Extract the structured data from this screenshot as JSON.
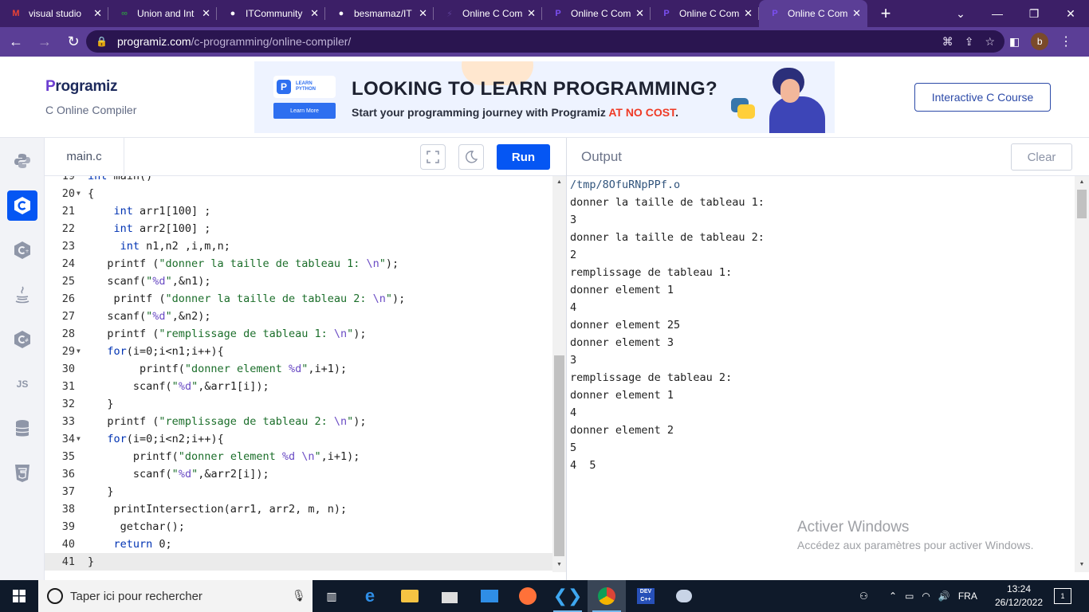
{
  "browser": {
    "tabs": [
      {
        "title": "visual studio",
        "icon": "gmail-icon",
        "active": false
      },
      {
        "title": "Union and Int",
        "icon": "geeksforgeeks-icon",
        "active": false
      },
      {
        "title": "ITCommunity",
        "icon": "github-icon",
        "active": false
      },
      {
        "title": "besmamaz/IT",
        "icon": "github-icon",
        "active": false
      },
      {
        "title": "Online C Com",
        "icon": "replit-icon",
        "active": false
      },
      {
        "title": "Online C Com",
        "icon": "programiz-icon",
        "active": false
      },
      {
        "title": "Online C Com",
        "icon": "programiz-icon",
        "active": false
      },
      {
        "title": "Online C Com",
        "icon": "programiz-icon",
        "active": true
      }
    ],
    "url_host": "programiz.com",
    "url_path": "/c-programming/online-compiler/",
    "profile_initial": "b",
    "colors": {
      "tabbar": "#3c1f67",
      "addressbar": "#5b3e96"
    }
  },
  "site": {
    "logo_text": "rogramiz",
    "logo_mark": "P",
    "subtitle": "C Online Compiler",
    "banner": {
      "card_text": "LEARN PYTHON",
      "button": "Learn More",
      "headline": "LOOKING TO LEARN PROGRAMMING?",
      "tagline_start": "Start your programming journey with Programiz ",
      "tagline_highlight": "AT NO COST",
      "tagline_end": "."
    },
    "course_button": "Interactive C Course",
    "accent_color": "#0556f3"
  },
  "sidebar": {
    "languages": [
      {
        "name": "python-icon",
        "active": false
      },
      {
        "name": "c-icon",
        "active": true
      },
      {
        "name": "cpp-icon",
        "active": false
      },
      {
        "name": "java-icon",
        "active": false
      },
      {
        "name": "csharp-icon",
        "active": false
      },
      {
        "name": "javascript-icon",
        "label": "JS",
        "active": false
      },
      {
        "name": "sql-icon",
        "active": false
      },
      {
        "name": "html5-icon",
        "active": false
      }
    ]
  },
  "editor": {
    "filename": "main.c",
    "run_label": "Run",
    "lines": [
      {
        "n": "19",
        "code": "int main()",
        "fold": false
      },
      {
        "n": "20",
        "code": "{",
        "fold": true
      },
      {
        "n": "21",
        "code": "    int arr1[100] ;",
        "fold": false
      },
      {
        "n": "22",
        "code": "    int arr2[100] ;",
        "fold": false
      },
      {
        "n": "23",
        "code": "     int n1,n2 ,i,m,n;",
        "fold": false
      },
      {
        "n": "24",
        "code": "   printf (\"donner la taille de tableau 1: \\n\");",
        "fold": false
      },
      {
        "n": "25",
        "code": "   scanf(\"%d\",&n1);",
        "fold": false
      },
      {
        "n": "26",
        "code": "    printf (\"donner la taille de tableau 2: \\n\");",
        "fold": false
      },
      {
        "n": "27",
        "code": "   scanf(\"%d\",&n2);",
        "fold": false
      },
      {
        "n": "28",
        "code": "   printf (\"remplissage de tableau 1: \\n\");",
        "fold": false
      },
      {
        "n": "29",
        "code": "   for(i=0;i<n1;i++){",
        "fold": true
      },
      {
        "n": "30",
        "code": "        printf(\"donner element %d\",i+1);",
        "fold": false
      },
      {
        "n": "31",
        "code": "       scanf(\"%d\",&arr1[i]);",
        "fold": false
      },
      {
        "n": "32",
        "code": "   }",
        "fold": false
      },
      {
        "n": "33",
        "code": "   printf (\"remplissage de tableau 2: \\n\");",
        "fold": false
      },
      {
        "n": "34",
        "code": "   for(i=0;i<n2;i++){",
        "fold": true
      },
      {
        "n": "35",
        "code": "       printf(\"donner element %d \\n\",i+1);",
        "fold": false
      },
      {
        "n": "36",
        "code": "       scanf(\"%d\",&arr2[i]);",
        "fold": false
      },
      {
        "n": "37",
        "code": "   }",
        "fold": false
      },
      {
        "n": "38",
        "code": "    printIntersection(arr1, arr2, m, n);",
        "fold": false
      },
      {
        "n": "39",
        "code": "     getchar();",
        "fold": false
      },
      {
        "n": "40",
        "code": "    return 0;",
        "fold": false
      },
      {
        "n": "41",
        "code": "}",
        "fold": false
      }
    ],
    "active_line": "41"
  },
  "output": {
    "label": "Output",
    "clear_label": "Clear",
    "lines": [
      "/tmp/8OfuRNpPPf.o",
      "donner la taille de tableau 1:",
      "3",
      "donner la taille de tableau 2:",
      "2",
      "remplissage de tableau 1:",
      "donner element 1",
      "4",
      "donner element 25",
      "donner element 3",
      "3",
      "remplissage de tableau 2:",
      "donner element 1",
      "4",
      "donner element 2",
      "5",
      "4  5"
    ]
  },
  "watermark": {
    "title": "Activer Windows",
    "subtitle": "Accédez aux paramètres pour activer Windows."
  },
  "taskbar": {
    "search_placeholder": "Taper ici pour rechercher",
    "language": "FRA",
    "time": "13:24",
    "date": "26/12/2022",
    "notifications": "1"
  }
}
